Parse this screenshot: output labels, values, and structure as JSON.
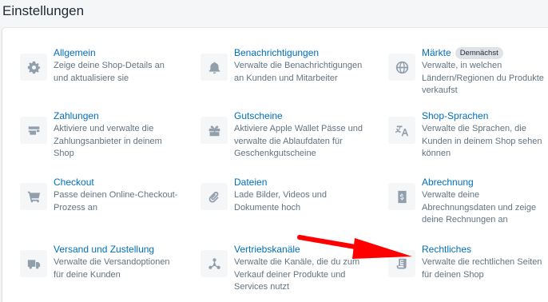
{
  "header": {
    "title": "Einstellungen"
  },
  "items": [
    {
      "title": "Allgemein",
      "badge": "",
      "desc1": "Zeige deine Shop-Details an",
      "desc2": "und aktualisiere sie",
      "desc3": "",
      "icon": "gear-icon"
    },
    {
      "title": "Benachrichtigungen",
      "badge": "",
      "desc1": "Verwalte die Benachrichtigungen",
      "desc2": "an Kunden und Mitarbeiter",
      "desc3": "",
      "icon": "bell-icon"
    },
    {
      "title": "Märkte",
      "badge": "Demnächst",
      "desc1": "Verwalte, in welchen",
      "desc2": "Ländern/Regionen du Produkte",
      "desc3": "verkaufst",
      "icon": "globe-icon"
    },
    {
      "title": "Zahlungen",
      "badge": "",
      "desc1": "Aktiviere und verwalte die",
      "desc2": "Zahlungsanbieter in deinem",
      "desc3": "Shop",
      "icon": "payment-card-icon"
    },
    {
      "title": "Gutscheine",
      "badge": "",
      "desc1": "Aktiviere Apple Wallet Pässe und",
      "desc2": "verwalte die Ablaufdaten für",
      "desc3": "Geschenkgutscheine",
      "icon": "gift-icon"
    },
    {
      "title": "Shop-Sprachen",
      "badge": "",
      "desc1": "Verwalte die Sprachen, die",
      "desc2": "Kunden in deinem Shop sehen",
      "desc3": "können",
      "icon": "translate-icon"
    },
    {
      "title": "Checkout",
      "badge": "",
      "desc1": "Passe deinen Online-Checkout-",
      "desc2": "Prozess an",
      "desc3": "",
      "icon": "cart-icon"
    },
    {
      "title": "Dateien",
      "badge": "",
      "desc1": "Lade Bilder, Videos und",
      "desc2": "Dokumente hoch",
      "desc3": "",
      "icon": "paperclip-icon"
    },
    {
      "title": "Abrechnung",
      "badge": "",
      "desc1": "Verwalte deine",
      "desc2": "Abrechnungsdaten und zeige",
      "desc3": "deine Rechnungen an",
      "icon": "billing-icon"
    },
    {
      "title": "Versand und Zustellung",
      "badge": "",
      "desc1": "Verwalte die Versandoptionen",
      "desc2": "für deine Kunden",
      "desc3": "",
      "icon": "truck-icon"
    },
    {
      "title": "Vertriebskanäle",
      "badge": "",
      "desc1": "Verwalte die Kanäle, die du zum",
      "desc2": "Verkauf deiner Produkte und",
      "desc3": "Services nutzt",
      "icon": "channels-icon"
    },
    {
      "title": "Rechtliches",
      "badge": "",
      "desc1": "Verwalte die rechtlichen Seiten",
      "desc2": "für deinen Shop",
      "desc3": "",
      "icon": "legal-document-icon"
    }
  ],
  "annotation": {
    "color": "#ff0000"
  }
}
